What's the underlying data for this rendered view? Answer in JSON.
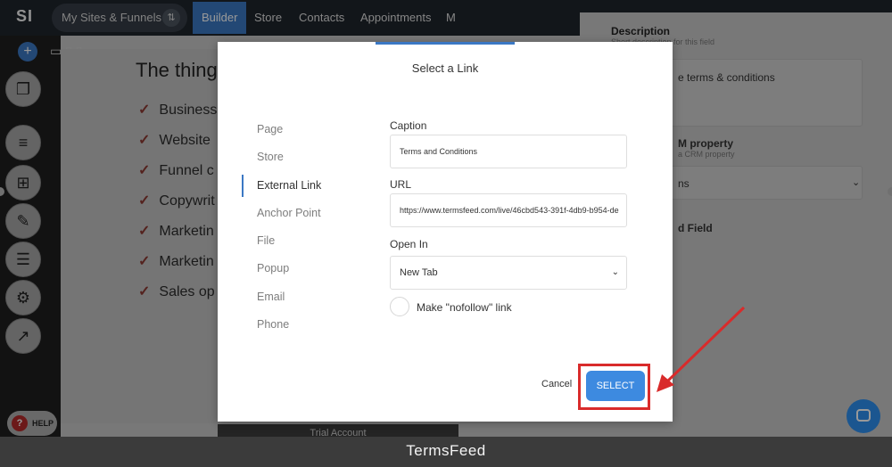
{
  "app": {
    "logo": "SI",
    "site_switcher": "My Sites & Funnels",
    "swap_icon": "⇅",
    "nav": [
      "Builder",
      "Store",
      "Contacts",
      "Appointments",
      "M"
    ],
    "headline": "The thing",
    "bullets": [
      "Business",
      "Website",
      "Funnel c",
      "Copywrit",
      "Marketin",
      "Marketin",
      "Sales op"
    ],
    "right_panel": {
      "description_label": "Description",
      "description_hint": "Short description for this field",
      "description_value": "e terms & conditions",
      "crm_label": "M property",
      "crm_hint": "a CRM property",
      "crm_value": "ns",
      "field_label": "d Field"
    },
    "help_label": "HELP",
    "trial_label": "Trial Account"
  },
  "modal": {
    "title": "Select a Link",
    "link_types": [
      {
        "label": "Page",
        "active": false
      },
      {
        "label": "Store",
        "active": false
      },
      {
        "label": "External Link",
        "active": true
      },
      {
        "label": "Anchor Point",
        "active": false
      },
      {
        "label": "File",
        "active": false
      },
      {
        "label": "Popup",
        "active": false
      },
      {
        "label": "Email",
        "active": false
      },
      {
        "label": "Phone",
        "active": false
      }
    ],
    "caption_label": "Caption",
    "caption_value": "Terms and Conditions",
    "url_label": "URL",
    "url_value": "https://www.termsfeed.com/live/46cbd543-391f-4db9-b954-de",
    "open_in_label": "Open In",
    "open_in_value": "New Tab",
    "nofollow_label": "Make \"nofollow\" link",
    "cancel_label": "Cancel",
    "select_label": "SELECT"
  },
  "footer_caption": "TermsFeed",
  "colors": {
    "accent": "#3d8ae0",
    "annotation": "#d92b2b"
  }
}
